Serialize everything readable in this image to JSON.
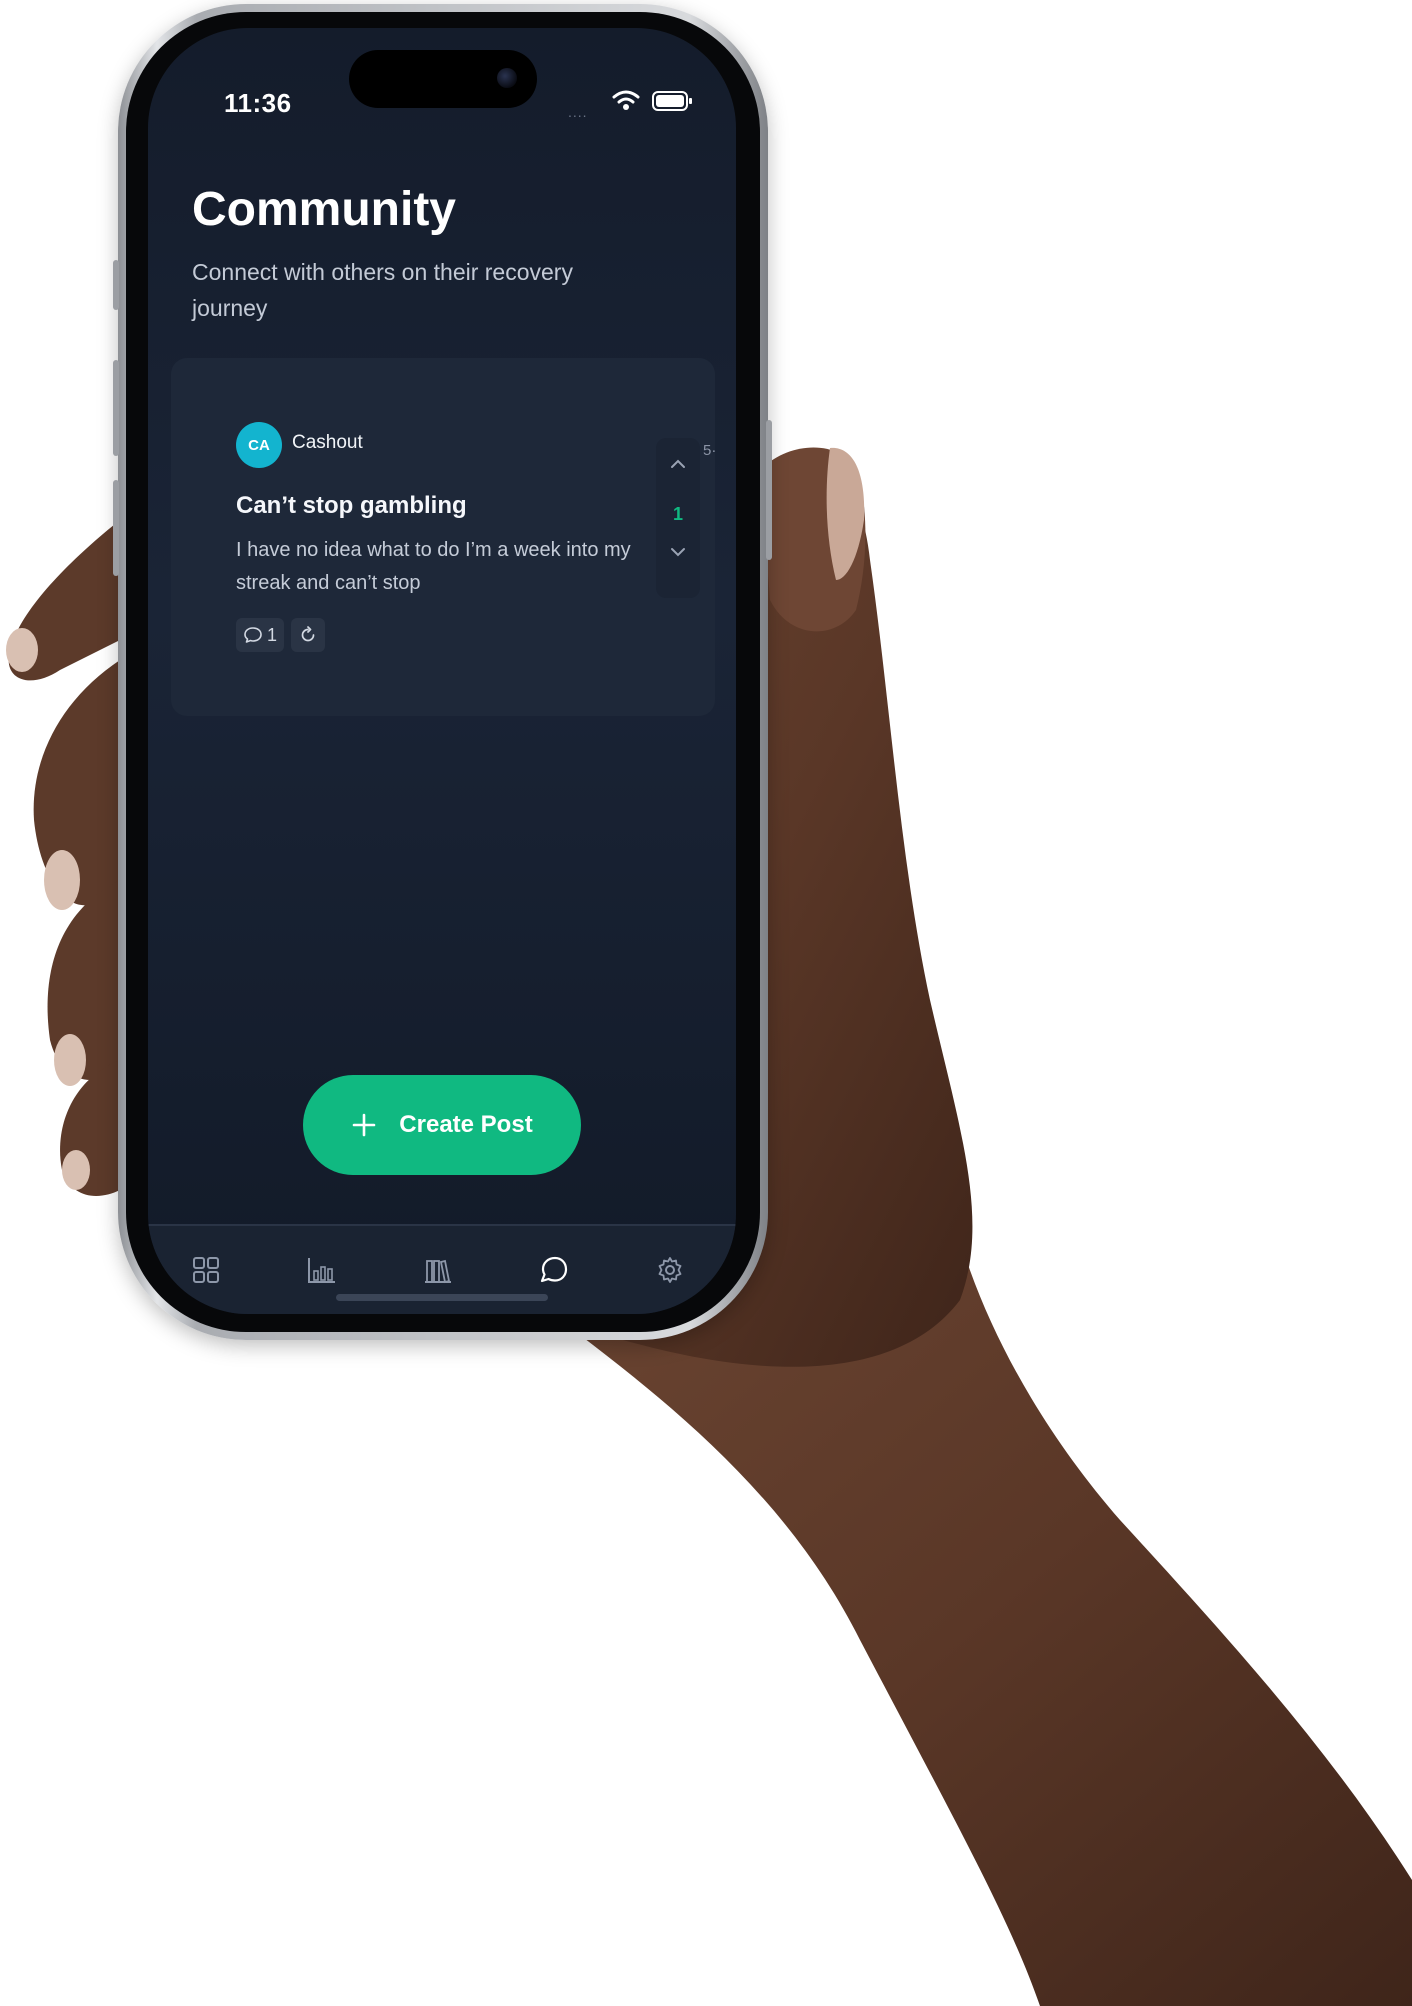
{
  "status_bar": {
    "time": "11:36",
    "signal_dots": "....",
    "icons": [
      "wifi-icon",
      "battery-icon"
    ]
  },
  "header": {
    "title": "Community",
    "subtitle": "Connect with others on their recovery journey"
  },
  "post": {
    "author_initials": "CA",
    "author": "Cashout",
    "title": "Can’t stop gambling",
    "body": "I have no idea what to do I’m a week into my streak and can’t stop",
    "votes": "1",
    "clipped_number": "5·",
    "comments_count": "1",
    "icons": [
      "chevron-up-icon",
      "chevron-down-icon",
      "comment-icon",
      "refresh-icon"
    ]
  },
  "actions": {
    "create_post_label": "Create Post",
    "create_post_icon": "plus-icon"
  },
  "tab_bar": {
    "items": [
      {
        "name": "dashboard",
        "icon": "grid-icon"
      },
      {
        "name": "stats",
        "icon": "bar-chart-icon"
      },
      {
        "name": "library",
        "icon": "library-icon"
      },
      {
        "name": "community",
        "icon": "chat-bubble-icon",
        "active": true
      },
      {
        "name": "settings",
        "icon": "gear-icon"
      }
    ]
  },
  "colors": {
    "accent": "#10b981",
    "avatar": "#13b4cf",
    "background": "#141c2b",
    "card": "#1e2839"
  }
}
